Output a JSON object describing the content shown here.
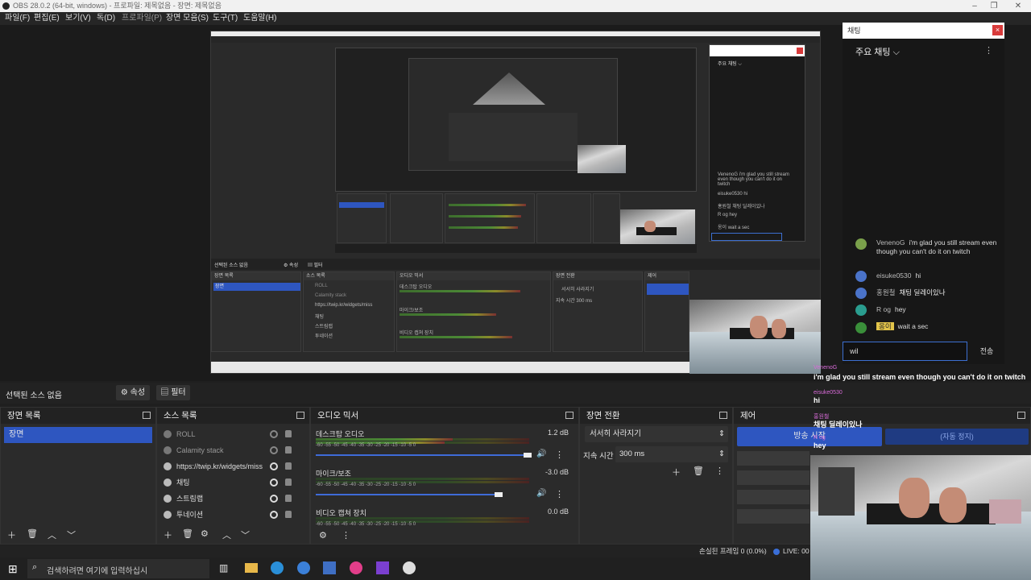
{
  "window": {
    "title": "OBS 28.0.2 (64-bit, windows) - 프로파일: 제목없음 - 장면: 제목없음"
  },
  "menu": [
    "파일(F)",
    "편집(E)",
    "보기(V)",
    "독(D)",
    "프로파일(P)",
    "장면 모음(S)",
    "도구(T)",
    "도움말(H)"
  ],
  "source_bar": {
    "no_source": "선택된 소스 없음",
    "properties": "속성",
    "filters": "필터"
  },
  "scenes": {
    "title": "장면 목록",
    "items": [
      "장면"
    ]
  },
  "sources": {
    "title": "소스 목록",
    "items": [
      "ROLL",
      "Calamity stack",
      "https://twip.kr/widgets/miss",
      "채팅",
      "스트림랩",
      "투네이션"
    ]
  },
  "mixer": {
    "title": "오디오 믹서",
    "scale": "-60  -55  -50  -45  -40  -35  -30  -25  -20  -15  -10  -5  0",
    "channels": [
      {
        "name": "데스크탑 오디오",
        "db": "1.2 dB"
      },
      {
        "name": "마이크/보조",
        "db": "-3.0 dB"
      },
      {
        "name": "비디오 캡쳐 장치",
        "db": "0.0 dB"
      }
    ]
  },
  "transitions": {
    "title": "장면 전환",
    "selected": "서서히 사라지기",
    "duration_label": "지속 시간",
    "duration_value": "300 ms"
  },
  "controls": {
    "title": "제어",
    "start_stream": "방송 시작",
    "autoconfig": "(자동 정지)"
  },
  "status": {
    "dropped": "손실된 프레임 0 (0.0%)",
    "live": "LIVE: 00"
  },
  "taskbar": {
    "search_placeholder": "검색하려면 여기에 입력하십시"
  },
  "chat": {
    "window_title": "채팅",
    "header": "주요 채팅",
    "messages": [
      {
        "name": "VenenoG",
        "text": "i'm glad you still stream even though you can't do it on twitch",
        "color": "#7aa04b"
      },
      {
        "name": "eisuke0530",
        "text": "hi",
        "color": "#4a73c9"
      },
      {
        "name": "홍원철",
        "text": "채팅 딜레이있나",
        "color": "#4a73c9"
      },
      {
        "name": "R og",
        "text": "hey",
        "color": "#2a9d8f"
      },
      {
        "name": "옹이",
        "text": "wait a sec",
        "color": "#3a8f3a"
      }
    ],
    "input_value": "wil",
    "send": "전송"
  },
  "overlay_chat": [
    {
      "name": "VenenoG",
      "text": "i'm glad you still stream even though you can't do it on twitch"
    },
    {
      "name": "eisuke0530",
      "text": "hi"
    },
    {
      "name": "홍원철",
      "text": "채팅 딜레이있나"
    },
    {
      "name": "R og",
      "text": "hey"
    }
  ]
}
